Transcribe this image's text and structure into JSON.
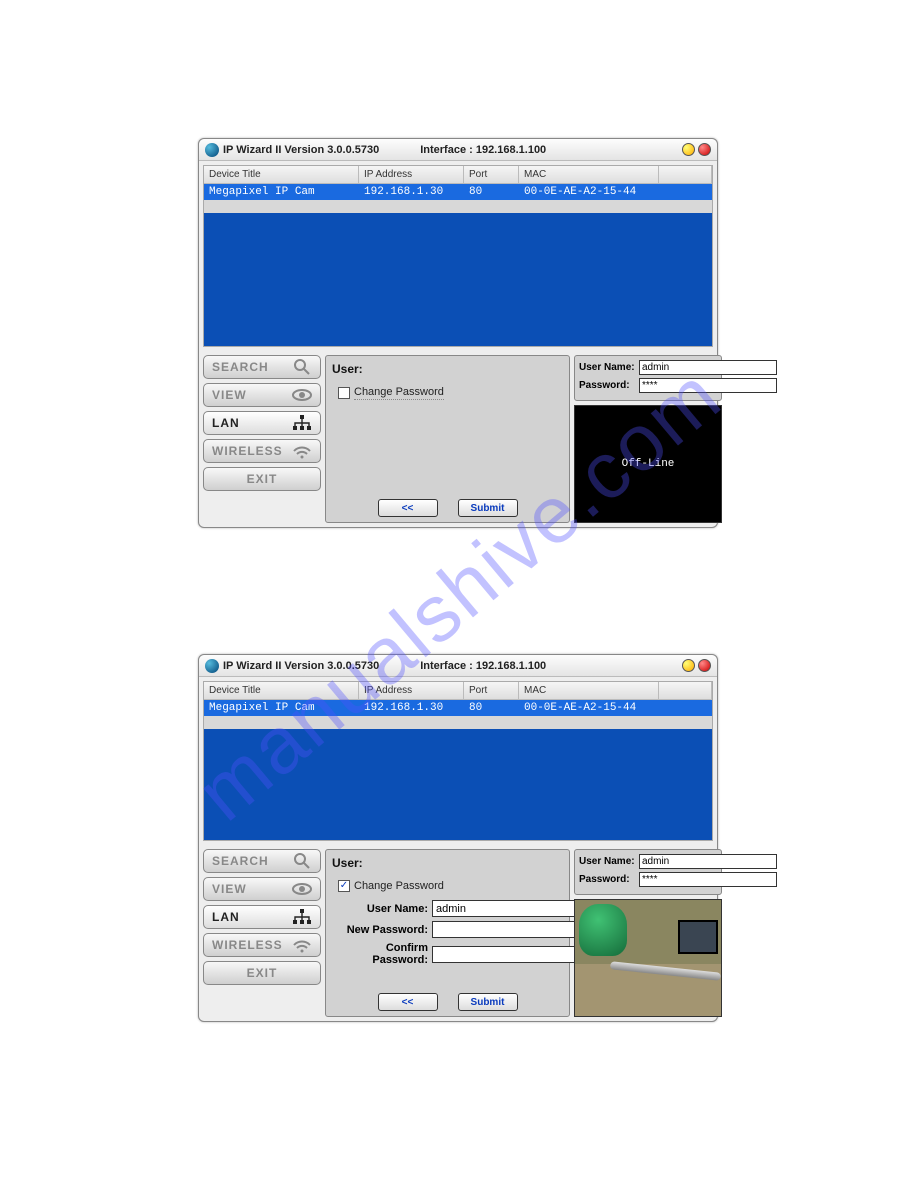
{
  "watermark": "manualshive.com",
  "titlebar": {
    "app_title": "IP Wizard II  Version 3.0.0.5730",
    "interface_label": "Interface : 192.168.1.100"
  },
  "columns": {
    "c0": "Device Title",
    "c1": "IP Address",
    "c2": "Port",
    "c3": "MAC"
  },
  "device": {
    "title": "Megapixel IP Cam",
    "ip": "192.168.1.30",
    "port": "80",
    "mac": "00-0E-AE-A2-15-44"
  },
  "sidebar": {
    "search": "SEARCH",
    "view": "VIEW",
    "lan": "LAN",
    "wireless": "WIRELESS",
    "exit": "EXIT"
  },
  "panel": {
    "heading": "User:",
    "change_password_label": "Change Password",
    "back_label": "<<",
    "submit_label": "Submit",
    "form": {
      "user_name_label": "User Name:",
      "new_password_label": "New Password:",
      "confirm_password_label": "Confirm Password:",
      "user_name_value": "admin",
      "new_password_value": "",
      "confirm_password_value": ""
    }
  },
  "credentials": {
    "username_label": "User Name:",
    "password_label": "Password:",
    "top": {
      "username_value": "admin",
      "password_value": "****"
    },
    "bottom": {
      "username_value": "admin",
      "password_value": "****"
    }
  },
  "preview": {
    "offline_text": "Off-Line"
  }
}
